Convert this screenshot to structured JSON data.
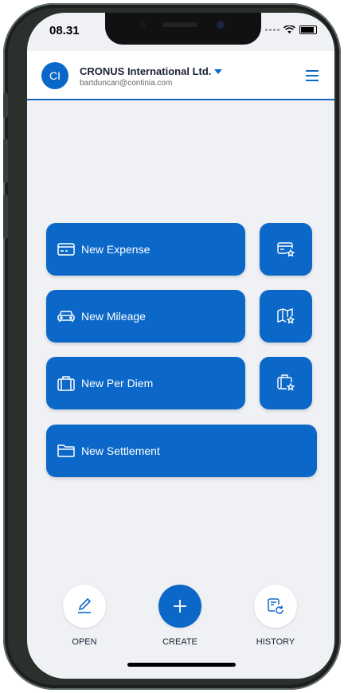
{
  "status": {
    "time": "08.31"
  },
  "header": {
    "avatar_initials": "CI",
    "company": "CRONUS International Ltd.",
    "email": "bartduncan@continia.com"
  },
  "buttons": {
    "expense": "New Expense",
    "mileage": "New Mileage",
    "perdiem": "New Per Diem",
    "settlement": "New Settlement"
  },
  "actions": {
    "open": "OPEN",
    "create": "CREATE",
    "history": "HISTORY"
  },
  "colors": {
    "accent": "#0b68c8",
    "background": "#eff1f5"
  }
}
